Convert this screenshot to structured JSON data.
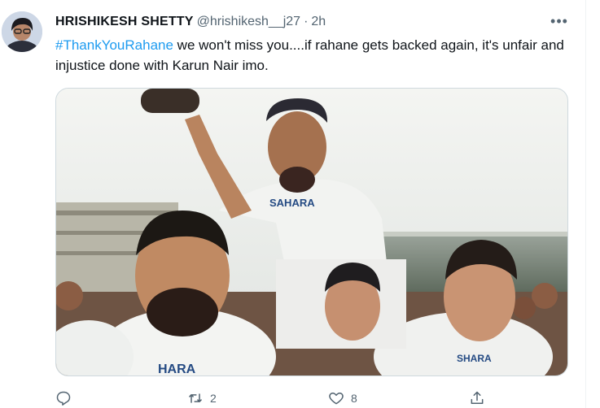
{
  "tweet": {
    "display_name": "HRISHIKESH SHETTY",
    "handle": "@hrishikesh__j27",
    "separator": "·",
    "time": "2h",
    "more_icon": "ellipsis-icon",
    "hashtag": "#ThankYouRahane",
    "text": " we won't miss you....if rahane gets backed again, it's unfair and injustice done with Karun Nair imo.",
    "image_texts": {
      "jersey_sponsor_1": "SAHARA",
      "jersey_sponsor_2": "HARA",
      "jersey_sponsor_3": "SHARA"
    }
  },
  "actions": {
    "reply": {
      "icon": "reply-icon",
      "count": ""
    },
    "retweet": {
      "icon": "retweet-icon",
      "count": "2"
    },
    "like": {
      "icon": "heart-icon",
      "count": "8"
    },
    "share": {
      "icon": "share-icon",
      "count": ""
    }
  },
  "colors": {
    "link": "#1d9bf0",
    "muted_text": "#536471",
    "text": "#0f1419",
    "border": "#cfd9de"
  }
}
